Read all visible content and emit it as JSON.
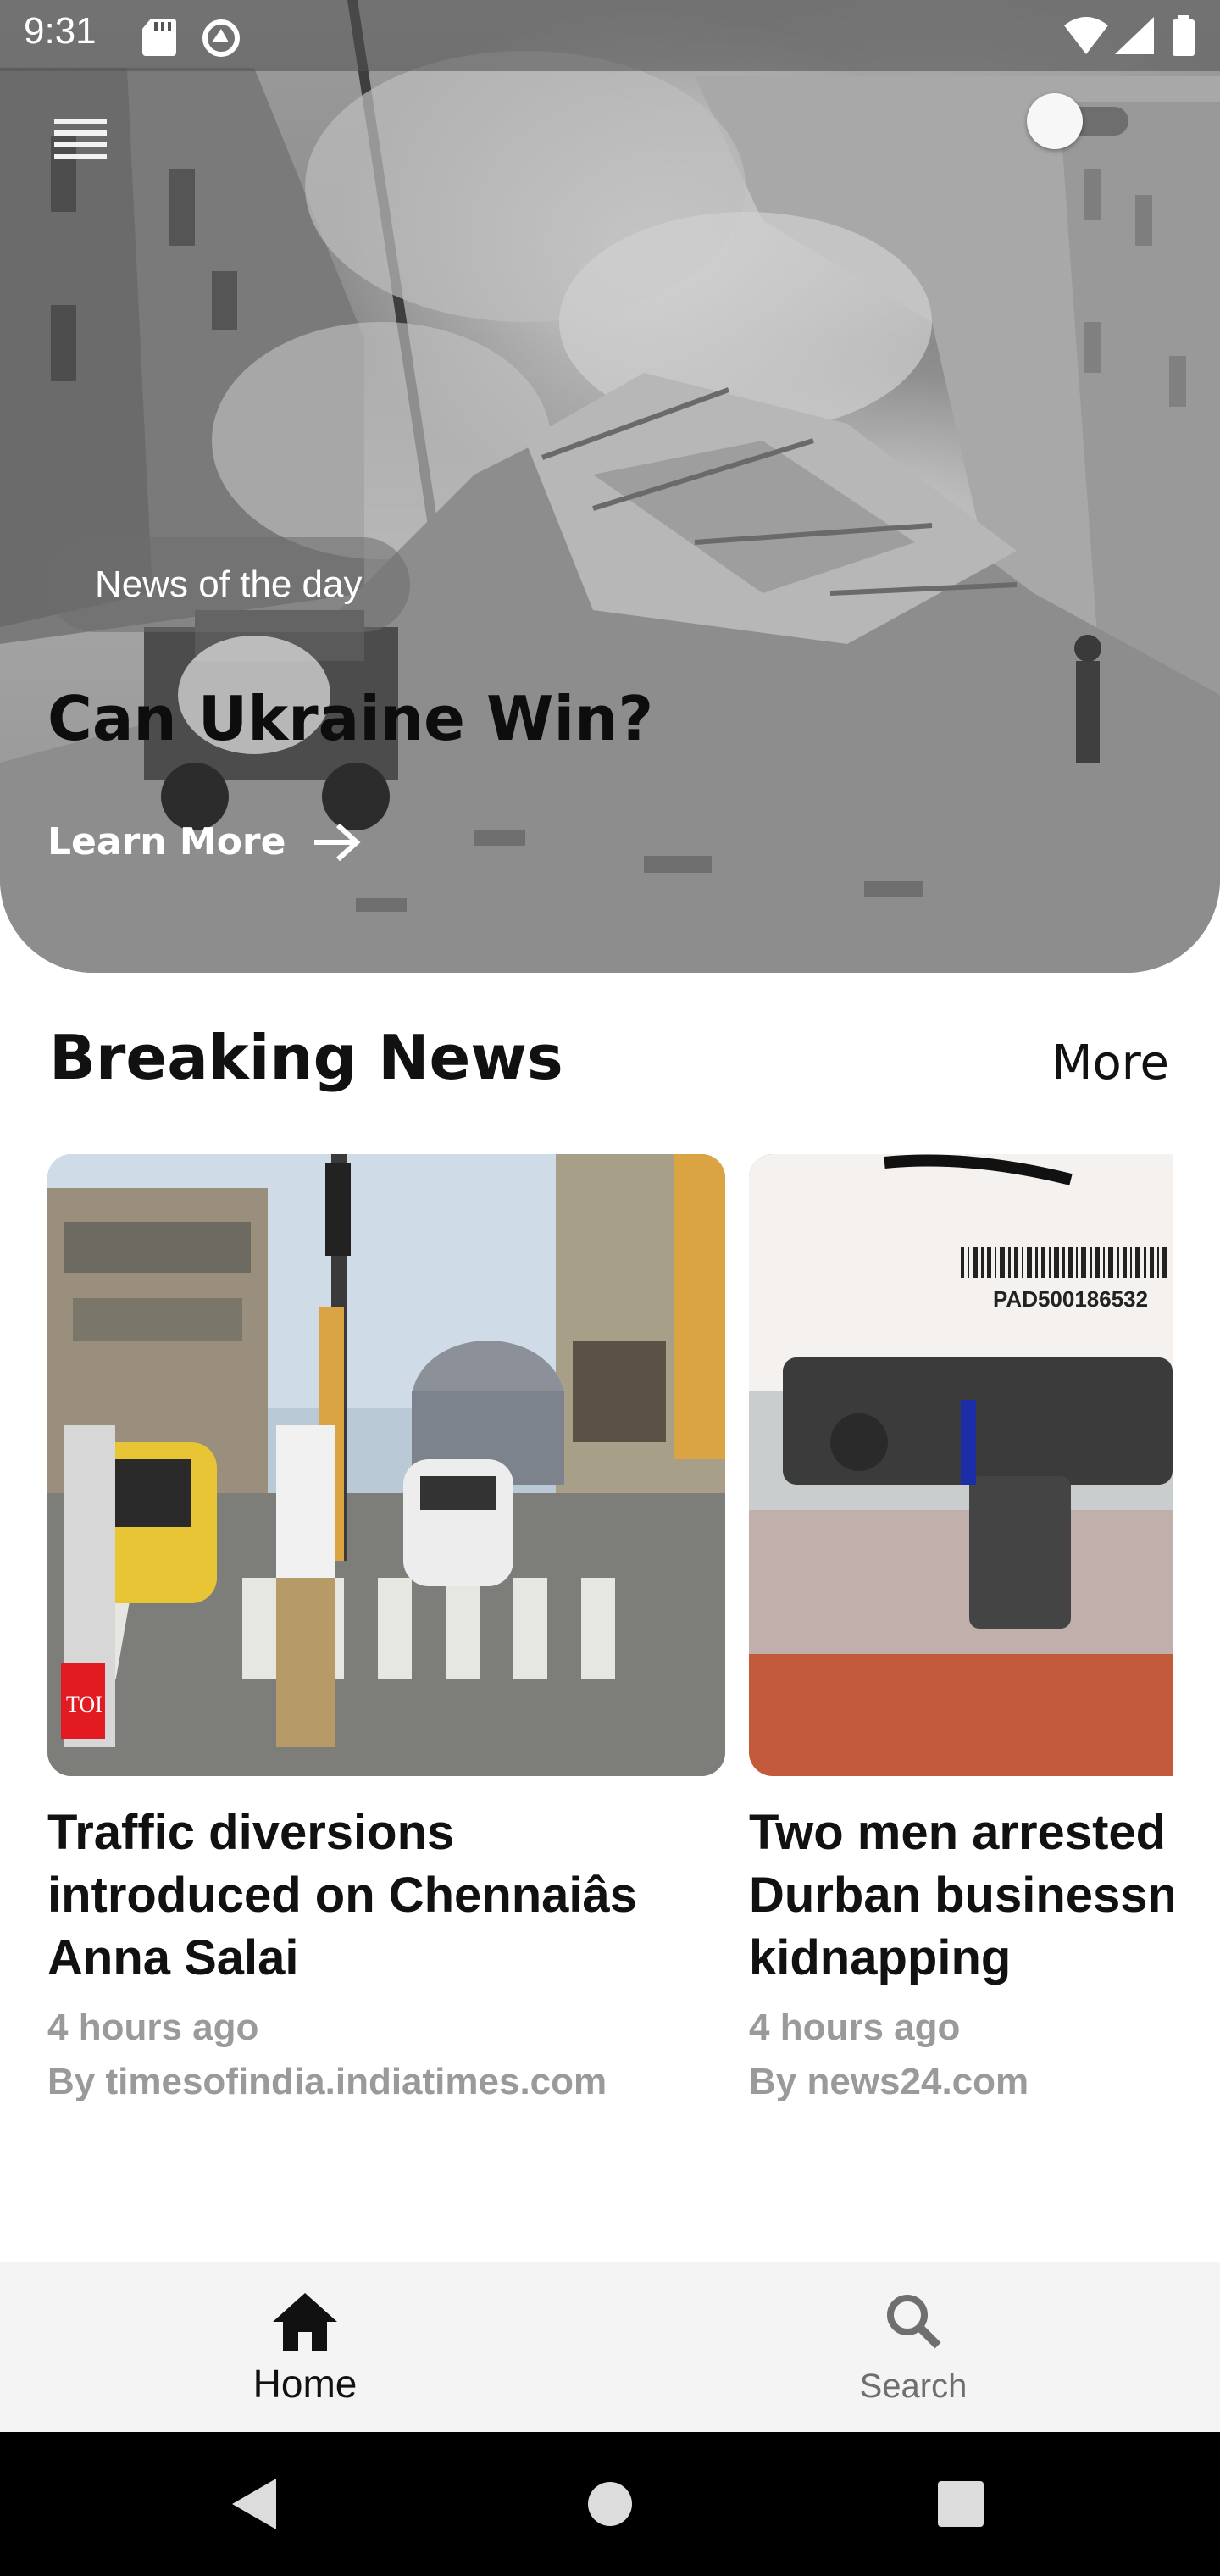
{
  "status_bar": {
    "time": "9:31"
  },
  "hero": {
    "tag": "News of the day",
    "headline": "Can Ukraine Win?",
    "cta_label": "Learn More",
    "theme_toggle_on": false
  },
  "breaking": {
    "title": "Breaking News",
    "more_label": "More",
    "cards": [
      {
        "title": "Traffic diversions\nintroduced on Chennaiâs\nAnna Salai",
        "time": "4 hours ago",
        "source": "By timesofindia.indiatimes.com",
        "badge": "TOI"
      },
      {
        "title": "Two men arrested\nDurban businessn\nkidnapping",
        "time": "4 hours ago",
        "source": "By news24.com",
        "label_code": "PAD500186532"
      }
    ]
  },
  "bottom_nav": {
    "items": [
      {
        "label": "Home",
        "icon": "home-icon",
        "active": true
      },
      {
        "label": "Search",
        "icon": "search-icon",
        "active": false
      }
    ]
  },
  "colors": {
    "text_primary": "#111111",
    "text_secondary": "#9a9a9a",
    "nav_bg": "#f4f4f4"
  }
}
